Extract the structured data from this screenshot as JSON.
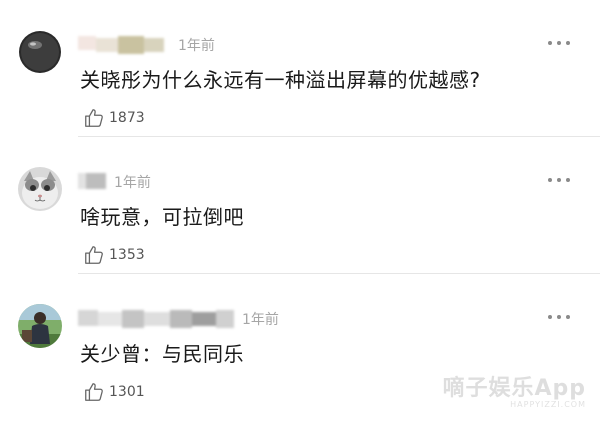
{
  "comments": [
    {
      "time": "1年前",
      "text": "关晓彤为什么永远有一种溢出屏幕的优越感?",
      "likes": "1873",
      "avatar_icon": "dark-sphere-avatar",
      "username_blurred": true
    },
    {
      "time": "1年前",
      "text": "啥玩意，可拉倒吧",
      "likes": "1353",
      "avatar_icon": "cat-avatar",
      "username_blurred": true
    },
    {
      "time": "1年前",
      "text": "关少曾：与民同乐",
      "likes": "1301",
      "avatar_icon": "outdoor-person-avatar",
      "username_blurred": true
    }
  ],
  "watermark": {
    "text": "嘀子娱乐App",
    "subtext": "HAPPYIZZI.COM"
  },
  "colors": {
    "text": "#1a1a1a",
    "muted": "#a6a6a6",
    "divider": "#e6e6e6"
  }
}
